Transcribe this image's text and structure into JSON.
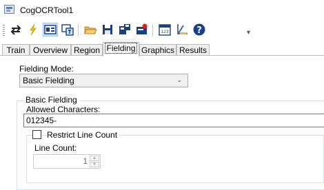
{
  "window": {
    "title": "CogOCRTool1",
    "icon": "app-window-icon"
  },
  "toolbar": {
    "buttons": [
      {
        "name": "refresh-icon"
      },
      {
        "name": "run-lightning-icon"
      },
      {
        "name": "image-display-icon"
      },
      {
        "name": "train-image-icon"
      },
      {
        "name": "open-folder-icon"
      },
      {
        "name": "save-icon"
      },
      {
        "name": "save-settings-icon"
      },
      {
        "name": "record-icon"
      },
      {
        "name": "calculator-icon"
      },
      {
        "name": "ruler-icon"
      },
      {
        "name": "help-icon"
      }
    ],
    "overflow": "▾"
  },
  "tabs": [
    {
      "label": "Train"
    },
    {
      "label": "Overview"
    },
    {
      "label": "Region"
    },
    {
      "label": "Fielding",
      "selected": true
    },
    {
      "label": "Graphics"
    },
    {
      "label": "Results"
    }
  ],
  "fielding": {
    "mode_label": "Fielding Mode:",
    "mode_value": "Basic Fielding",
    "group_title": "Basic Fielding",
    "allowed_label": "Allowed Characters:",
    "allowed_value": "012345-",
    "restrict_label": "Restrict Line Count",
    "restrict_checked": false,
    "line_count_label": "Line Count:",
    "line_count_value": "1",
    "line_count_enabled": false
  }
}
